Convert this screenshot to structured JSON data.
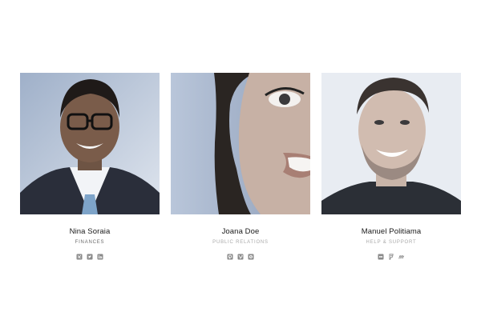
{
  "team": {
    "members": [
      {
        "name": "Nina Soraia",
        "role": "FINANCES",
        "role_color": "#6b6b6b",
        "socials": [
          "xing-icon",
          "twitter-icon",
          "linkedin-icon"
        ]
      },
      {
        "name": "Joana Doe",
        "role": "PUBLIC RELATIONS",
        "role_color": "#a9a9a9",
        "socials": [
          "pinterest-icon",
          "vimeo-icon",
          "skype-icon"
        ]
      },
      {
        "name": "Manuel Politiama",
        "role": "HELP & SUPPORT",
        "role_color": "#a9a9a9",
        "socials": [
          "flickr-icon",
          "foursquare-icon",
          "meetup-icon"
        ]
      }
    ]
  },
  "colors": {
    "photo_tint": "#b4c2d8",
    "icon": "#8a8a8a"
  }
}
